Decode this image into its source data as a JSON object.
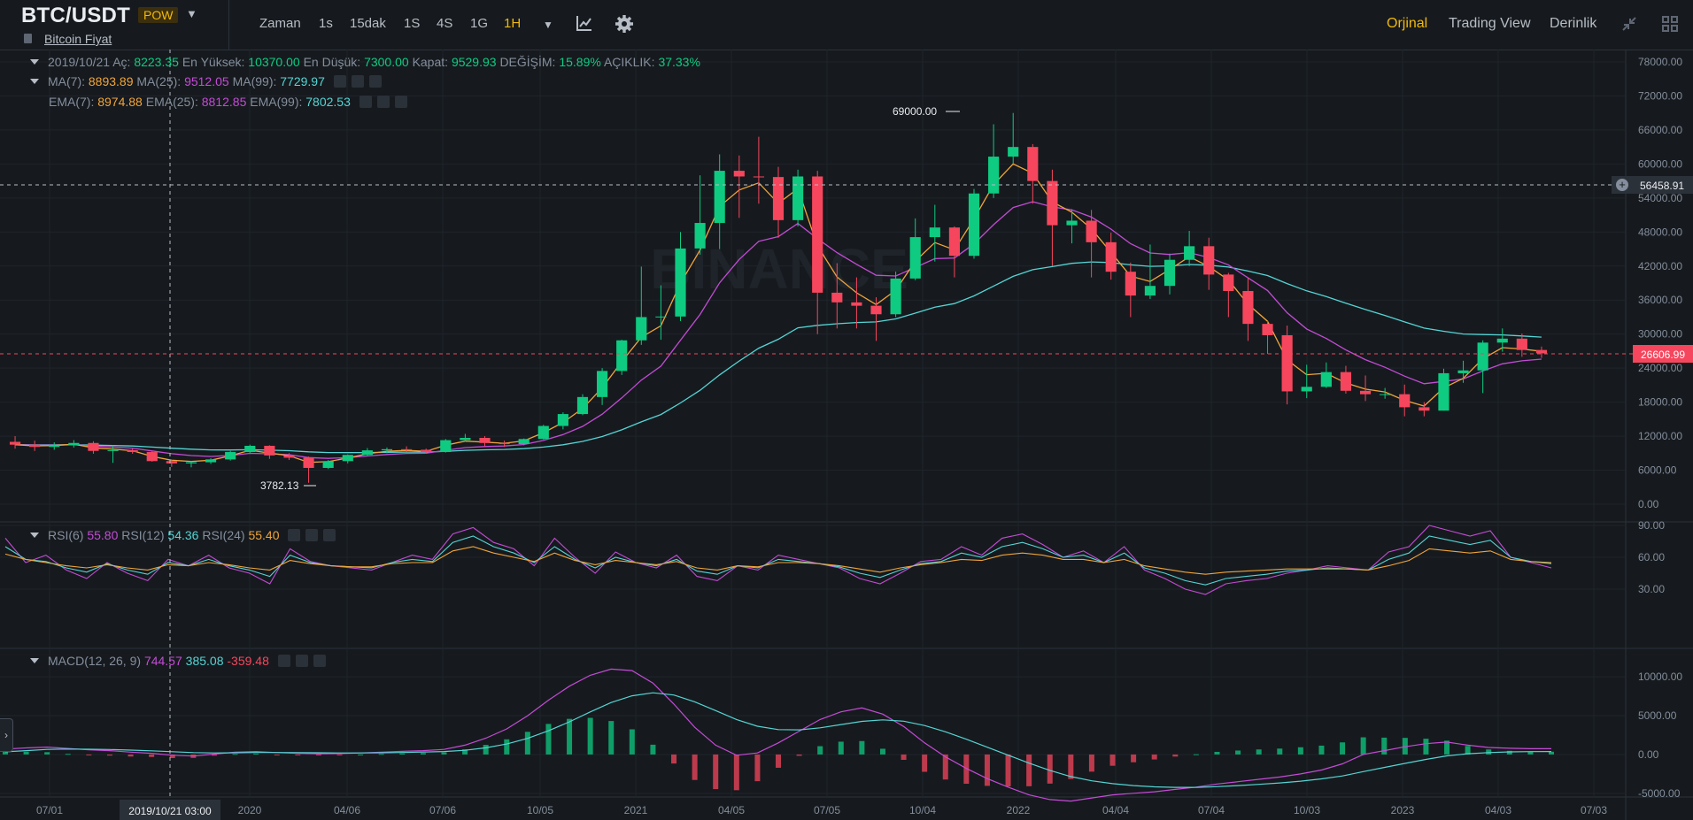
{
  "header": {
    "symbol": "BTC/USDT",
    "badge": "POW",
    "subtitle": "Bitcoin Fiyat",
    "timeframes": [
      "Zaman",
      "1s",
      "15dak",
      "1S",
      "4S",
      "1G",
      "1H"
    ],
    "active_timeframe": "1H",
    "views": [
      "Orjinal",
      "Trading View",
      "Derinlik"
    ],
    "active_view": "Orjinal",
    "icons": [
      "chart-type-icon",
      "settings-icon",
      "collapse-icon",
      "grid-layout-icon"
    ]
  },
  "ohlc_legend": {
    "date": "2019/10/21",
    "open_label": "Aç:",
    "open": "8223.35",
    "high_label": "En Yüksek:",
    "high": "10370.00",
    "low_label": "En Düşük:",
    "low": "7300.00",
    "close_label": "Kapat:",
    "close": "9529.93",
    "change_label": "DEĞİŞİM:",
    "change": "15.89%",
    "amplitude_label": "AÇIKLIK:",
    "amplitude": "37.33%"
  },
  "ma_legend": {
    "ma7_label": "MA(7):",
    "ma7": "8893.89",
    "ma25_label": "MA(25):",
    "ma25": "9512.05",
    "ma99_label": "MA(99):",
    "ma99": "7729.97"
  },
  "ema_legend": {
    "ema7_label": "EMA(7):",
    "ema7": "8974.88",
    "ema25_label": "EMA(25):",
    "ema25": "8812.85",
    "ema99_label": "EMA(99):",
    "ema99": "7802.53"
  },
  "rsi_legend": {
    "rsi6_label": "RSI(6)",
    "rsi6": "55.80",
    "rsi12_label": "RSI(12)",
    "rsi12": "54.36",
    "rsi24_label": "RSI(24)",
    "rsi24": "55.40"
  },
  "macd_legend": {
    "label": "MACD(12, 26, 9)",
    "macd": "744.57",
    "signal": "385.08",
    "hist": "-359.48"
  },
  "crosshair": {
    "price": "56458.91",
    "time": "2019/10/21 03:00"
  },
  "last_price": "26606.99",
  "annotations": {
    "high": "69000.00",
    "low": "3782.13"
  },
  "watermark": "BINANCE",
  "colors": {
    "up": "#0ecb81",
    "down": "#f6465d",
    "accent": "#f0b90b",
    "bg": "#161a1e"
  },
  "chart_data": [
    {
      "type": "candlestick",
      "title": "BTC/USDT",
      "x_ticks": [
        "07/01",
        "2020",
        "04/06",
        "07/06",
        "10/05",
        "2021",
        "04/05",
        "07/05",
        "10/04",
        "2022",
        "04/04",
        "07/04",
        "10/03",
        "2023",
        "04/03",
        "07/03"
      ],
      "y_ticks": [
        "78000.00",
        "72000.00",
        "66000.00",
        "60000.00",
        "54000.00",
        "48000.00",
        "42000.00",
        "36000.00",
        "30000.00",
        "24000.00",
        "18000.00",
        "12000.00",
        "6000.00",
        "0.00"
      ],
      "ylim": [
        0,
        78000
      ],
      "candles": [
        [
          11000,
          12000,
          9800,
          10500
        ],
        [
          10500,
          11200,
          9400,
          10100
        ],
        [
          10100,
          10900,
          9600,
          10400
        ],
        [
          10400,
          11300,
          10000,
          10800
        ],
        [
          10800,
          11100,
          8900,
          9400
        ],
        [
          9400,
          10370,
          7300,
          9530
        ],
        [
          9530,
          9800,
          8900,
          9200
        ],
        [
          9200,
          9400,
          7500,
          7600
        ],
        [
          7600,
          7800,
          6600,
          7200
        ],
        [
          7200,
          7600,
          6500,
          7400
        ],
        [
          7400,
          8100,
          7100,
          7900
        ],
        [
          7900,
          9400,
          7700,
          9200
        ],
        [
          9200,
          10500,
          9000,
          10300
        ],
        [
          10300,
          10400,
          8000,
          8600
        ],
        [
          8600,
          9000,
          7800,
          8200
        ],
        [
          8200,
          8400,
          3782,
          6400
        ],
        [
          6400,
          7800,
          6200,
          7600
        ],
        [
          7600,
          8800,
          7200,
          8700
        ],
        [
          8700,
          9900,
          8500,
          9500
        ],
        [
          9500,
          10000,
          9000,
          9700
        ],
        [
          9700,
          10200,
          9300,
          9600
        ],
        [
          9600,
          9800,
          8900,
          9200
        ],
        [
          9200,
          11500,
          9100,
          11300
        ],
        [
          11300,
          12400,
          11000,
          11700
        ],
        [
          11700,
          12000,
          10200,
          10800
        ],
        [
          10800,
          11200,
          10100,
          10600
        ],
        [
          10600,
          11600,
          10400,
          11500
        ],
        [
          11500,
          14000,
          11400,
          13800
        ],
        [
          13800,
          16200,
          13200,
          15900
        ],
        [
          15900,
          19400,
          15700,
          18900
        ],
        [
          18900,
          24000,
          17500,
          23500
        ],
        [
          23500,
          29000,
          22800,
          28900
        ],
        [
          28900,
          41900,
          28100,
          33000
        ],
        [
          33000,
          38600,
          29000,
          33100
        ],
        [
          33100,
          48000,
          32300,
          45100
        ],
        [
          45100,
          58000,
          44000,
          49600
        ],
        [
          49600,
          61700,
          45000,
          58800
        ],
        [
          58800,
          61500,
          50500,
          57800
        ],
        [
          57800,
          64800,
          53000,
          57700
        ],
        [
          57700,
          59500,
          47000,
          50100
        ],
        [
          50100,
          59000,
          49000,
          57800
        ],
        [
          57800,
          58800,
          30000,
          37300
        ],
        [
          37300,
          42500,
          31000,
          35600
        ],
        [
          35600,
          40000,
          31000,
          35000
        ],
        [
          35000,
          36500,
          28800,
          33500
        ],
        [
          33500,
          41000,
          33000,
          39800
        ],
        [
          39800,
          50400,
          39500,
          47100
        ],
        [
          47100,
          52800,
          42800,
          48800
        ],
        [
          48800,
          49000,
          40000,
          43800
        ],
        [
          43800,
          55600,
          43300,
          54800
        ],
        [
          54800,
          67000,
          54000,
          61300
        ],
        [
          61300,
          69000,
          60000,
          63000
        ],
        [
          63000,
          63500,
          53000,
          57000
        ],
        [
          57000,
          59000,
          42000,
          49200
        ],
        [
          49200,
          52000,
          46000,
          50000
        ],
        [
          50000,
          51900,
          40000,
          46200
        ],
        [
          46200,
          47900,
          39600,
          41000
        ],
        [
          41000,
          42600,
          33000,
          36800
        ],
        [
          36800,
          45800,
          36200,
          38500
        ],
        [
          38500,
          44200,
          37000,
          43100
        ],
        [
          43100,
          48200,
          42000,
          45500
        ],
        [
          45500,
          47000,
          37800,
          40500
        ],
        [
          40500,
          40800,
          33000,
          37600
        ],
        [
          37600,
          40000,
          28800,
          31800
        ],
        [
          31800,
          32300,
          26500,
          29800
        ],
        [
          29800,
          31500,
          17600,
          19900
        ],
        [
          19900,
          24600,
          18700,
          20700
        ],
        [
          20700,
          25000,
          20500,
          23300
        ],
        [
          23300,
          24400,
          19500,
          20000
        ],
        [
          20000,
          22700,
          18200,
          19400
        ],
        [
          19400,
          20500,
          18600,
          19400
        ],
        [
          19400,
          21100,
          15500,
          17100
        ],
        [
          17100,
          18000,
          15500,
          16500
        ],
        [
          16500,
          23900,
          16500,
          23100
        ],
        [
          23100,
          25300,
          21400,
          23600
        ],
        [
          23600,
          28900,
          19600,
          28500
        ],
        [
          28500,
          31000,
          26900,
          29200
        ],
        [
          29200,
          30100,
          26000,
          27200
        ],
        [
          27200,
          27800,
          25800,
          26607
        ]
      ],
      "overlays": [
        {
          "name": "MA(7)",
          "value": "8893.89"
        },
        {
          "name": "MA(25)",
          "value": "9512.05"
        },
        {
          "name": "MA(99)",
          "value": "7729.97"
        }
      ]
    },
    {
      "type": "line",
      "title": "RSI",
      "y_ticks": [
        "90.00",
        "60.00",
        "30.00"
      ],
      "ylim": [
        0,
        100
      ],
      "series": [
        {
          "name": "RSI(6)",
          "values": [
            78,
            55,
            62,
            48,
            40,
            55,
            45,
            38,
            58,
            52,
            62,
            50,
            45,
            35,
            68,
            56,
            52,
            50,
            48,
            55,
            62,
            58,
            82,
            88,
            74,
            68,
            52,
            78,
            60,
            45,
            65,
            55,
            50,
            62,
            42,
            38,
            52,
            48,
            62,
            58,
            54,
            50,
            40,
            35,
            45,
            56,
            58,
            70,
            62,
            78,
            82,
            72,
            60,
            66,
            55,
            70,
            48,
            40,
            30,
            25,
            35,
            38,
            40,
            45,
            48,
            52,
            50,
            48,
            65,
            70,
            90,
            85,
            80,
            85,
            60,
            55,
            50
          ]
        },
        {
          "name": "RSI(12)",
          "values": [
            70,
            58,
            56,
            50,
            46,
            54,
            48,
            44,
            55,
            52,
            58,
            52,
            48,
            42,
            62,
            55,
            52,
            51,
            50,
            55,
            58,
            56,
            74,
            80,
            70,
            64,
            55,
            70,
            58,
            50,
            60,
            55,
            52,
            58,
            47,
            44,
            52,
            50,
            58,
            56,
            54,
            51,
            45,
            41,
            48,
            54,
            56,
            64,
            60,
            70,
            74,
            68,
            60,
            62,
            55,
            64,
            50,
            45,
            38,
            34,
            40,
            42,
            44,
            47,
            48,
            50,
            49,
            48,
            58,
            64,
            80,
            76,
            72,
            76,
            60,
            56,
            54
          ]
        },
        {
          "name": "RSI(24)",
          "values": [
            63,
            58,
            55,
            52,
            50,
            53,
            50,
            48,
            53,
            52,
            55,
            53,
            50,
            48,
            57,
            54,
            52,
            51,
            51,
            54,
            55,
            55,
            66,
            70,
            64,
            60,
            56,
            64,
            57,
            53,
            57,
            55,
            53,
            56,
            50,
            48,
            52,
            51,
            55,
            55,
            54,
            52,
            49,
            46,
            50,
            53,
            55,
            58,
            57,
            62,
            64,
            62,
            58,
            58,
            55,
            58,
            52,
            49,
            46,
            44,
            46,
            47,
            48,
            49,
            49,
            49,
            49,
            48,
            52,
            57,
            68,
            66,
            64,
            66,
            58,
            56,
            55
          ]
        }
      ]
    },
    {
      "type": "line",
      "title": "MACD(12, 26, 9)",
      "y_ticks": [
        "10000.00",
        "5000.00",
        "0.00",
        "-5000.00"
      ],
      "ylim": [
        -6500,
        11500
      ],
      "series": [
        {
          "name": "MACD",
          "values": [
            700,
            850,
            950,
            780,
            600,
            500,
            300,
            150,
            -100,
            -200,
            50,
            300,
            380,
            250,
            150,
            100,
            120,
            200,
            300,
            400,
            500,
            650,
            1200,
            2100,
            3300,
            5000,
            7000,
            8800,
            10200,
            11000,
            10800,
            9200,
            6500,
            3500,
            1200,
            -100,
            200,
            1500,
            3000,
            4500,
            5500,
            6000,
            5200,
            3600,
            1500,
            -300,
            -1800,
            -3100,
            -4200,
            -5200,
            -5800,
            -6000,
            -5600,
            -5200,
            -5000,
            -4800,
            -4500,
            -4200,
            -3800,
            -3500,
            -3200,
            -2900,
            -2500,
            -2000,
            -1200,
            0,
            500,
            1000,
            1400,
            1600,
            1200,
            900,
            800,
            750,
            744
          ]
        },
        {
          "name": "Signal",
          "values": [
            350,
            500,
            650,
            700,
            680,
            640,
            560,
            470,
            360,
            240,
            200,
            220,
            260,
            260,
            240,
            220,
            200,
            200,
            220,
            260,
            310,
            380,
            540,
            860,
            1350,
            2080,
            3060,
            4210,
            5480,
            6690,
            7560,
            7940,
            7660,
            6780,
            5660,
            4500,
            3640,
            3210,
            3170,
            3430,
            3850,
            4270,
            4460,
            4290,
            3730,
            2920,
            1970,
            940,
            -90,
            -1110,
            -2050,
            -2840,
            -3390,
            -3750,
            -4000,
            -4160,
            -4230,
            -4230,
            -4140,
            -4010,
            -3850,
            -3660,
            -3430,
            -3140,
            -2760,
            -2210,
            -1670,
            -1140,
            -630,
            -180,
            100,
            250,
            330,
            370,
            385
          ]
        }
      ]
    }
  ]
}
